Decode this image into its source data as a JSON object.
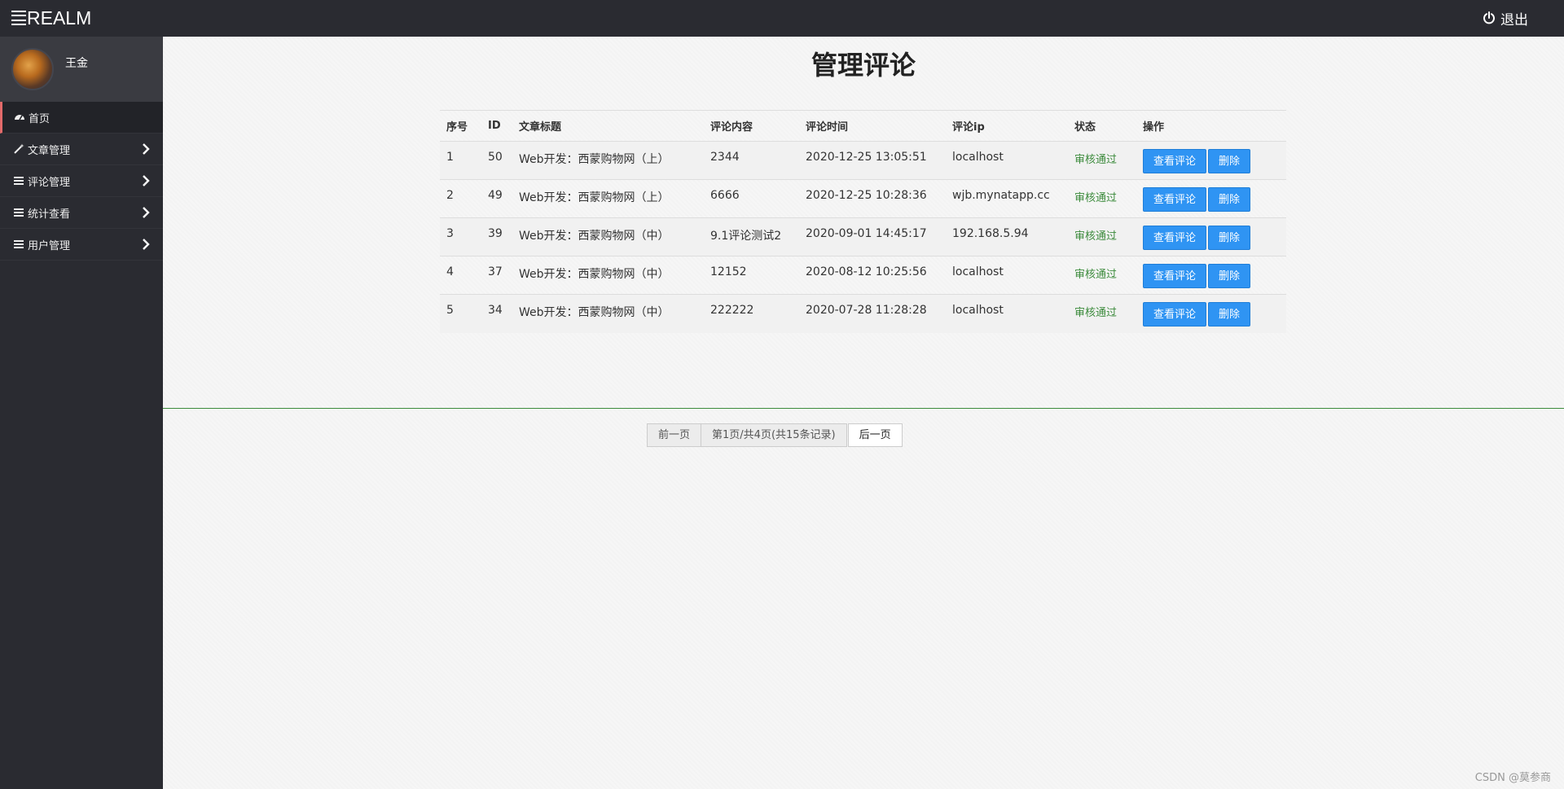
{
  "header": {
    "logo_text": "REALM",
    "logout_label": "退出"
  },
  "sidebar": {
    "user_name": "王金",
    "items": [
      {
        "label": "首页",
        "icon": "dashboard-icon"
      },
      {
        "label": "文章管理",
        "icon": "wand-icon"
      },
      {
        "label": "评论管理",
        "icon": "list-icon"
      },
      {
        "label": "统计查看",
        "icon": "list-icon"
      },
      {
        "label": "用户管理",
        "icon": "list-icon"
      }
    ]
  },
  "main": {
    "title": "管理评论",
    "table": {
      "headers": [
        "序号",
        "ID",
        "文章标题",
        "评论内容",
        "评论时间",
        "评论ip",
        "状态",
        "操作"
      ],
      "rows": [
        {
          "index": "1",
          "id": "50",
          "article": "Web开发：西蒙购物网（上）",
          "content": "2344",
          "time": "2020-12-25 13:05:51",
          "ip": "localhost",
          "status": "审核通过"
        },
        {
          "index": "2",
          "id": "49",
          "article": "Web开发：西蒙购物网（上）",
          "content": "6666",
          "time": "2020-12-25 10:28:36",
          "ip": "wjb.mynatapp.cc",
          "status": "审核通过"
        },
        {
          "index": "3",
          "id": "39",
          "article": "Web开发：西蒙购物网（中）",
          "content": "9.1评论测试2",
          "time": "2020-09-01 14:45:17",
          "ip": "192.168.5.94",
          "status": "审核通过"
        },
        {
          "index": "4",
          "id": "37",
          "article": "Web开发：西蒙购物网（中）",
          "content": "12152",
          "time": "2020-08-12 10:25:56",
          "ip": "localhost",
          "status": "审核通过"
        },
        {
          "index": "5",
          "id": "34",
          "article": "Web开发：西蒙购物网（中）",
          "content": "222222",
          "time": "2020-07-28 11:28:28",
          "ip": "localhost",
          "status": "审核通过"
        }
      ],
      "view_label": "查看评论",
      "delete_label": "删除"
    },
    "pager": {
      "prev_label": "前一页",
      "info": "第1页/共4页(共15条记录)",
      "next_label": "后一页"
    }
  },
  "watermark": "CSDN @莫参商",
  "colors": {
    "topbar": "#2a2b31",
    "sidebar_active_accent": "#e36a6a",
    "button_blue": "#2f94f3",
    "status_green": "#3c8b3c"
  }
}
